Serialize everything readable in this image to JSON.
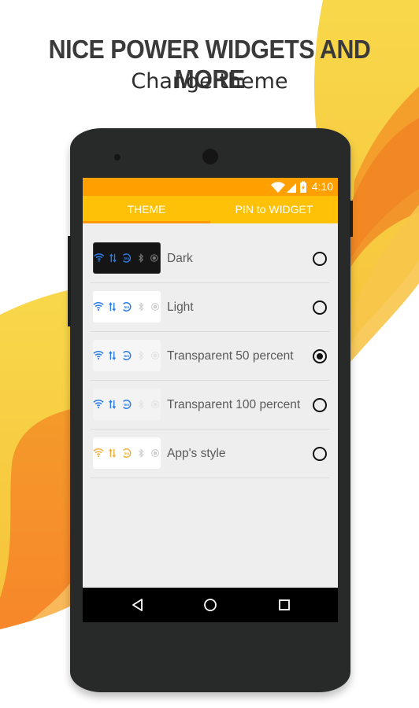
{
  "promo": {
    "headline": "NICE POWER WIDGETS AND MORE",
    "subheadline": "Change theme"
  },
  "colors": {
    "status_bar": "#ffa000",
    "tab_bar": "#ffc107",
    "tab_indicator": "#ff9800",
    "screen_bg": "#eeeeee",
    "phone_body": "#282a29",
    "icon_blue": "#2b7de9",
    "icon_orange": "#f0b040"
  },
  "status_bar": {
    "time": "4:10",
    "icons": [
      "wifi-icon",
      "signal-icon",
      "battery-charging-icon"
    ]
  },
  "tabs": [
    {
      "label": "THEME",
      "selected": true
    },
    {
      "label": "PIN to WIDGET",
      "selected": false
    }
  ],
  "themes": [
    {
      "label": "Dark",
      "style": "dark",
      "selected": false,
      "preview_icons": [
        "wifi-icon",
        "data-sync-icon",
        "timeout-icon",
        "bluetooth-icon",
        "location-icon"
      ]
    },
    {
      "label": "Light",
      "style": "light",
      "selected": false,
      "preview_icons": [
        "wifi-icon",
        "data-sync-icon",
        "timeout-icon",
        "bluetooth-icon",
        "location-icon"
      ]
    },
    {
      "label": "Transparent 50 percent",
      "style": "trans50",
      "selected": true,
      "preview_icons": [
        "wifi-icon",
        "data-sync-icon",
        "timeout-icon",
        "bluetooth-icon",
        "location-icon"
      ]
    },
    {
      "label": "Transparent 100 percent",
      "style": "trans100",
      "selected": false,
      "preview_icons": [
        "wifi-icon",
        "data-sync-icon",
        "timeout-icon",
        "bluetooth-icon",
        "location-icon"
      ]
    },
    {
      "label": "App's style",
      "style": "app",
      "selected": false,
      "preview_icons": [
        "wifi-icon",
        "data-sync-icon",
        "timeout-icon",
        "bluetooth-icon",
        "location-icon"
      ]
    }
  ],
  "nav_bar": {
    "buttons": [
      "back-icon",
      "home-icon",
      "recents-icon"
    ]
  }
}
